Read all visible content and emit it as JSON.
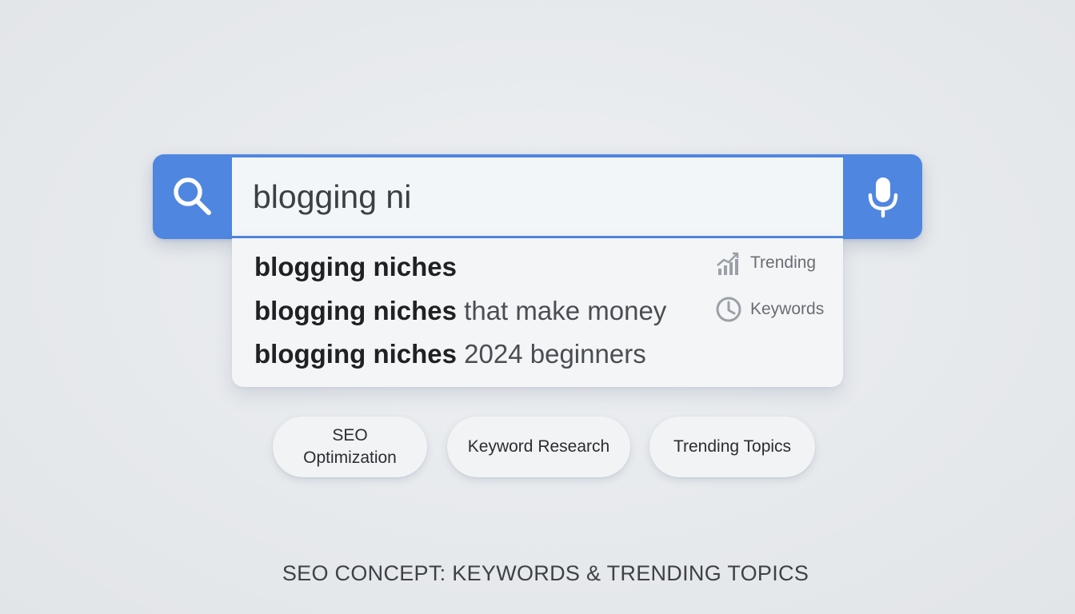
{
  "search": {
    "value": "blogging ni",
    "icon": "search-icon",
    "mic_icon": "microphone-icon"
  },
  "suggestions": [
    {
      "bold": "blogging niches",
      "rest": ""
    },
    {
      "bold": "blogging niches",
      "rest": " that make money"
    },
    {
      "bold": "blogging niches",
      "rest": " 2024 beginners"
    }
  ],
  "tags": {
    "trending": {
      "label": "Trending",
      "icon": "trending-chart-icon"
    },
    "keywords": {
      "label": "Keywords",
      "icon": "clock-icon"
    }
  },
  "chips": {
    "seo": "SEO Optimization",
    "keyword_research": "Keyword Research",
    "trending_topics": "Trending Topics"
  },
  "caption": "SEO CONCEPT: KEYWORDS & TRENDING TOPICS",
  "colors": {
    "accent": "#4f86e0",
    "background": "#e6e9ec",
    "input_bg": "#f3f6f9"
  }
}
